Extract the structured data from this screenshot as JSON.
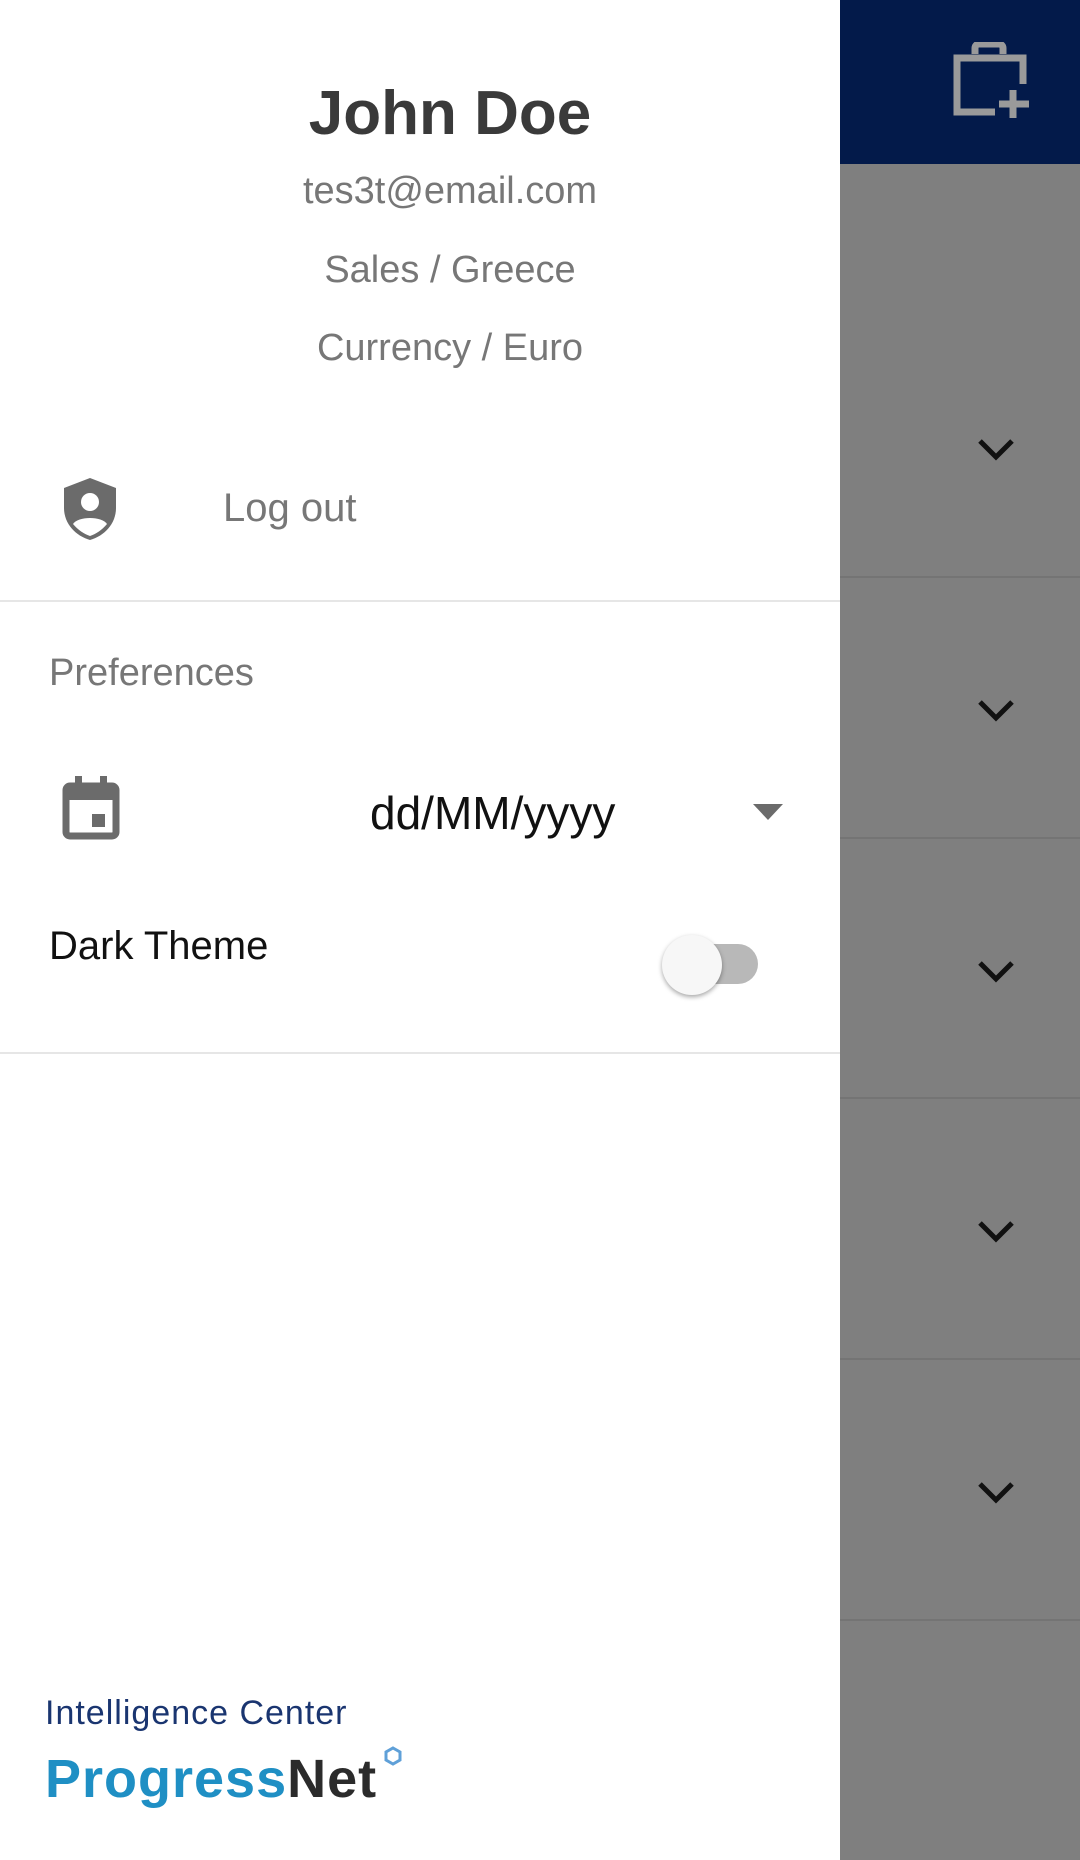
{
  "profile": {
    "name": "John Doe",
    "email": "tes3t@email.com",
    "department": "Sales / Greece",
    "currency": "Currency / Euro"
  },
  "logout": {
    "label": "Log out",
    "icon": "shield-account-icon"
  },
  "preferences": {
    "heading": "Preferences",
    "date_format": {
      "value": "dd/MM/yyyy",
      "icon": "calendar-icon"
    },
    "dark_theme": {
      "label": "Dark Theme",
      "enabled": false
    }
  },
  "footer": {
    "tagline": "Intelligence Center",
    "logo": "ProgressNet"
  },
  "background": {
    "header_icon": "briefcase-plus-icon",
    "header_color": "#031a4a"
  }
}
